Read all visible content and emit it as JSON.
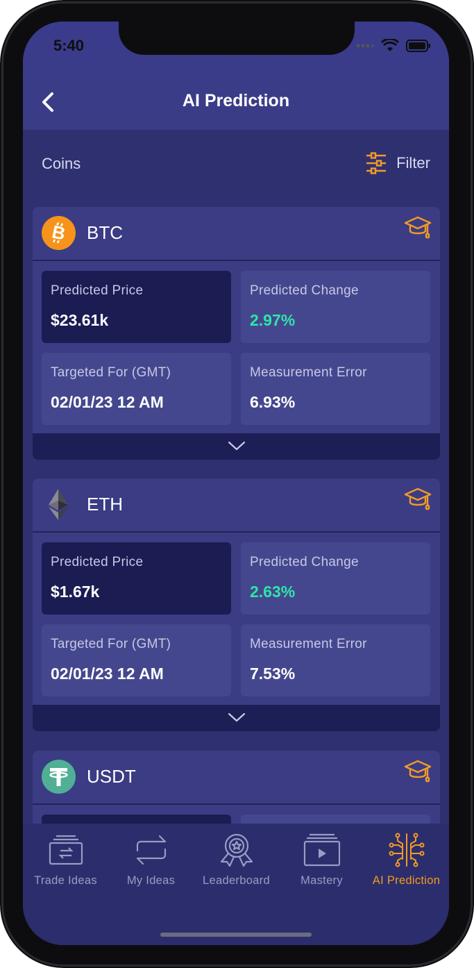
{
  "status": {
    "time": "5:40"
  },
  "header": {
    "title": "AI Prediction"
  },
  "subbar": {
    "coins_label": "Coins",
    "filter_label": "Filter"
  },
  "cards": [
    {
      "symbol": "BTC",
      "icon": "bitcoin-icon",
      "predicted_price_label": "Predicted Price",
      "predicted_price": "$23.61k",
      "predicted_change_label": "Predicted Change",
      "predicted_change": "2.97%",
      "targeted_label": "Targeted For (GMT)",
      "targeted": "02/01/23 12 AM",
      "error_label": "Measurement Error",
      "error": "6.93%"
    },
    {
      "symbol": "ETH",
      "icon": "ethereum-icon",
      "predicted_price_label": "Predicted Price",
      "predicted_price": "$1.67k",
      "predicted_change_label": "Predicted Change",
      "predicted_change": "2.63%",
      "targeted_label": "Targeted For (GMT)",
      "targeted": "02/01/23 12 AM",
      "error_label": "Measurement Error",
      "error": "7.53%"
    },
    {
      "symbol": "USDT",
      "icon": "tether-icon"
    }
  ],
  "tabs": [
    {
      "label": "Trade Ideas",
      "icon": "trade-ideas-icon"
    },
    {
      "label": "My Ideas",
      "icon": "my-ideas-icon"
    },
    {
      "label": "Leaderboard",
      "icon": "leaderboard-icon"
    },
    {
      "label": "Mastery",
      "icon": "mastery-icon"
    },
    {
      "label": "AI Prediction",
      "icon": "ai-prediction-icon",
      "active": true
    }
  ],
  "colors": {
    "background": "#2f3070",
    "card": "#3b3c84",
    "tile_dark": "#1a1c52",
    "positive": "#2ee5a9",
    "accent": "#f29b23",
    "bitcoin": "#f7931a",
    "tether": "#50af95"
  }
}
